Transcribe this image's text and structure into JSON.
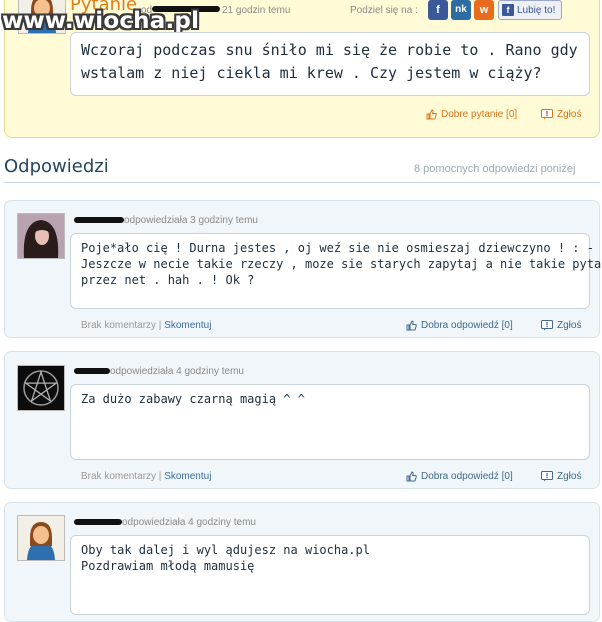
{
  "watermark": "www.wiocha.pl",
  "question": {
    "title": "Pytanie",
    "meta_prefix": "od",
    "meta_time": "21 godzin temu",
    "share_label": "Podziel się na :",
    "share_buttons": [
      {
        "name": "facebook-share",
        "glyph": "f",
        "color": "#3b5998"
      },
      {
        "name": "nk-share",
        "glyph": "nk",
        "color": "#2c6ca2"
      },
      {
        "name": "wykop-share",
        "glyph": "w",
        "color": "#e86b1e"
      }
    ],
    "like_label": "Lubię to!",
    "text_lines": [
      "Wczoraj podczas snu śniło mi się że robie to . Rano gdy",
      "wstalam z niej ciekla mi krew . Czy jestem w ciąży?"
    ],
    "good_question": "Dobre pytanie [0]",
    "report": "Zgłoś"
  },
  "answers_header": {
    "title": "Odpowiedzi",
    "count": "8 pomocnych odpowiedzi poniżej"
  },
  "answers": [
    {
      "meta": "odpowiedziała 3 godziny temu",
      "text_lines": [
        "Poje*ało cię ! Durna jestes , oj weź sie nie osmieszaj dziewczyno ! : - P",
        "Jeszcze w necie takie rzeczy , moze sie starych zapytaj a nie takie pytania",
        "przez net . hah . ! Ok ?"
      ],
      "no_comments": "Brak komentarzy",
      "comment": "Skomentuj",
      "good_answer": "Dobra odpowiedź [0]",
      "report": "Zgłoś"
    },
    {
      "meta": "odpowiedziała 4 godziny temu",
      "text_lines": [
        "Za dużo zabawy czarną magią ^ ^"
      ],
      "no_comments": "Brak komentarzy",
      "comment": "Skomentuj",
      "good_answer": "Dobra odpowiedź [0]",
      "report": "Zgłoś"
    },
    {
      "meta": "odpowiedziała 4 godziny temu",
      "text_lines": [
        "Oby tak dalej i wyl ądujesz na wiocha.pl",
        "Pozdrawiam młodą mamusię"
      ]
    }
  ]
}
